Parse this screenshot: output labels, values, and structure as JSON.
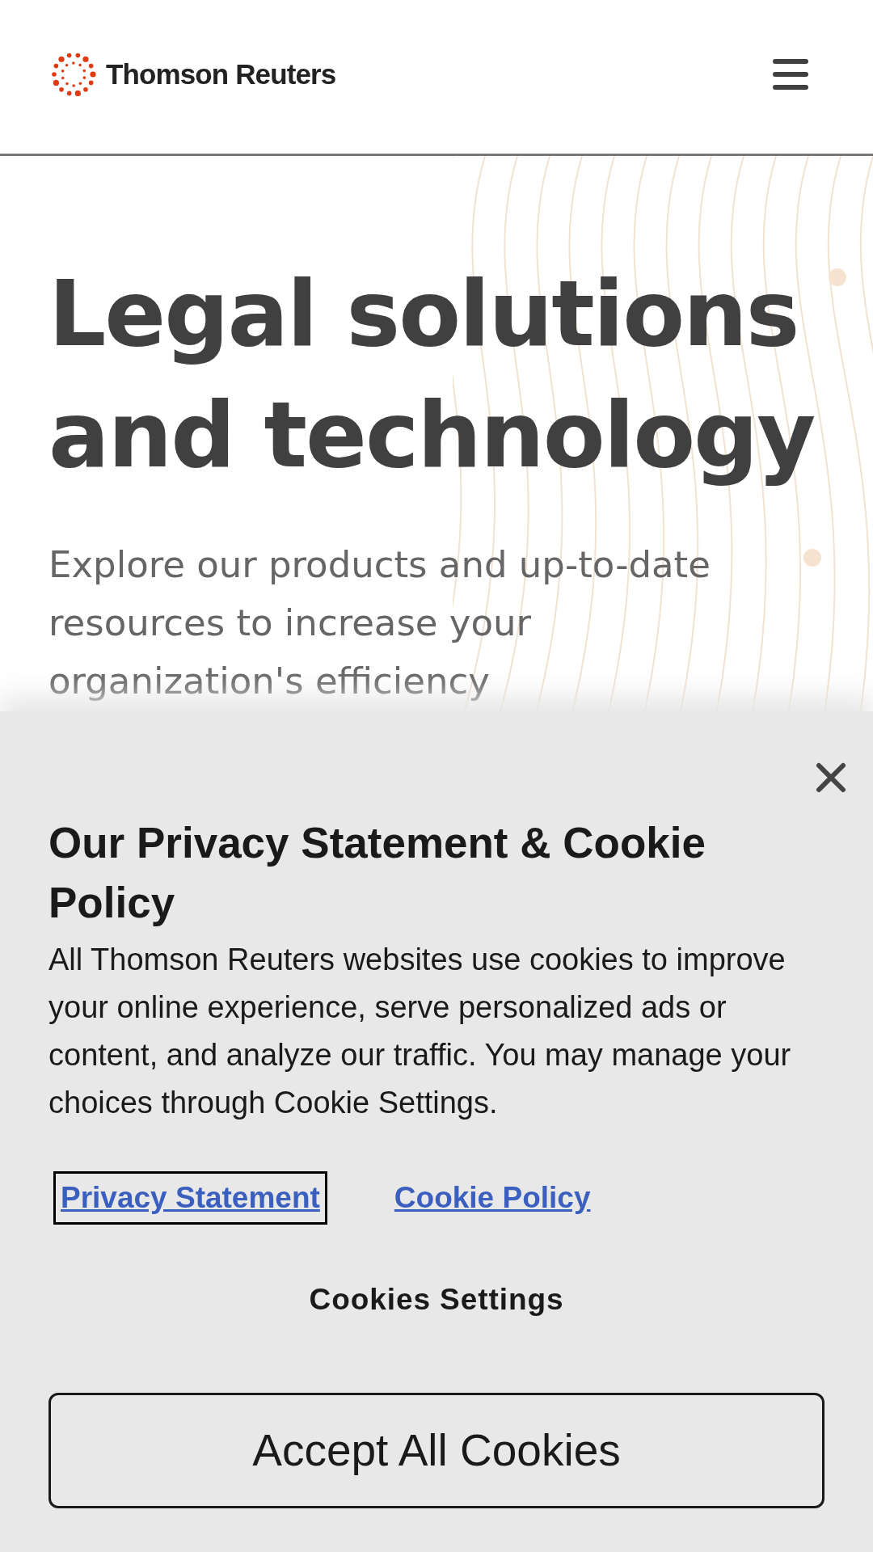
{
  "header": {
    "logo_text": "Thomson Reuters"
  },
  "hero": {
    "title_lines": [
      "Legal solutions",
      "and technology"
    ],
    "subtitle": "Explore our products and up-to-date resources to increase your organization's efficiency"
  },
  "cookie_banner": {
    "title": "Our Privacy Statement & Cookie Policy",
    "body": "All Thomson Reuters websites use cookies to improve your online experience, serve personalized ads or content, and analyze our traffic. You may manage your choices through Cookie Settings.",
    "links": [
      {
        "label": "Privacy Statement",
        "focused": true
      },
      {
        "label": "Cookie Policy",
        "focused": false
      }
    ],
    "settings_button": "Cookies Settings",
    "accept_button": "Accept All Cookies"
  }
}
